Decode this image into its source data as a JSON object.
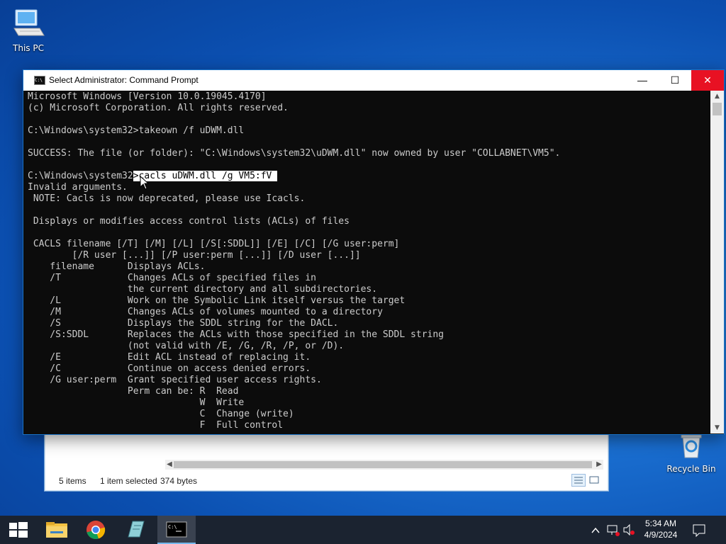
{
  "desktop": {
    "this_pc_label": "This PC",
    "recycle_bin_label": "Recycle Bin"
  },
  "explorer": {
    "status_items": "5 items",
    "status_selected": "1 item selected",
    "status_size": "374 bytes"
  },
  "cmd": {
    "title": "Select Administrator: Command Prompt",
    "icon_text": "C:\\",
    "lines_before": [
      "Microsoft Windows [Version 10.0.19045.4170]",
      "(c) Microsoft Corporation. All rights reserved.",
      "",
      "C:\\Windows\\system32>takeown /f uDWM.dll",
      "",
      "SUCCESS: The file (or folder): \"C:\\Windows\\system32\\uDWM.dll\" now owned by user \"COLLABNET\\VM5\".",
      ""
    ],
    "prompt_prefix": "C:\\Windows\\system32",
    "prompt_selected": ">cacls uDWM.dll /g VM5:fV ",
    "lines_after": [
      "Invalid arguments.",
      " NOTE: Cacls is now deprecated, please use Icacls.",
      "",
      " Displays or modifies access control lists (ACLs) of files",
      "",
      " CACLS filename [/T] [/M] [/L] [/S[:SDDL]] [/E] [/C] [/G user:perm]",
      "        [/R user [...]] [/P user:perm [...]] [/D user [...]]",
      "    filename      Displays ACLs.",
      "    /T            Changes ACLs of specified files in",
      "                  the current directory and all subdirectories.",
      "    /L            Work on the Symbolic Link itself versus the target",
      "    /M            Changes ACLs of volumes mounted to a directory",
      "    /S            Displays the SDDL string for the DACL.",
      "    /S:SDDL       Replaces the ACLs with those specified in the SDDL string",
      "                  (not valid with /E, /G, /R, /P, or /D).",
      "    /E            Edit ACL instead of replacing it.",
      "    /C            Continue on access denied errors.",
      "    /G user:perm  Grant specified user access rights.",
      "                  Perm can be: R  Read",
      "                               W  Write",
      "                               C  Change (write)",
      "                               F  Full control"
    ]
  },
  "taskbar": {
    "time": "5:34 AM",
    "date": "4/9/2024"
  }
}
